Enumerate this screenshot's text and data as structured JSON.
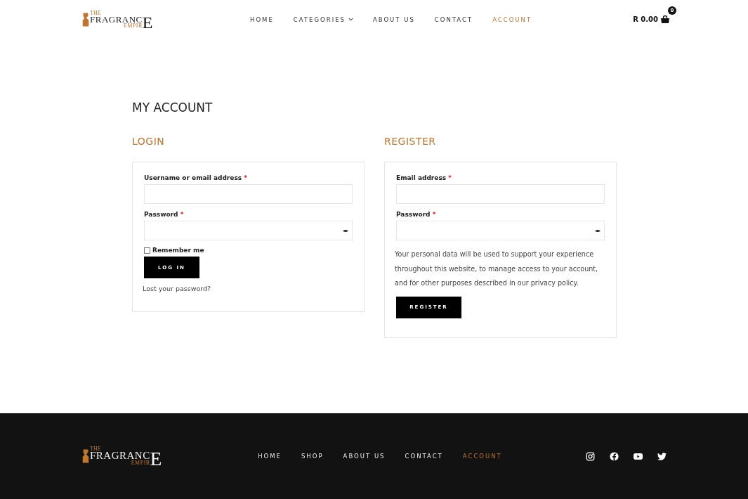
{
  "header": {
    "logo": {
      "top": "THE",
      "main": "FRAGRANC",
      "big": "E",
      "sub": "EMPIR"
    },
    "nav": [
      {
        "label": "HOME",
        "selected": false,
        "dropdown": false
      },
      {
        "label": "CATEGORIES",
        "selected": false,
        "dropdown": true
      },
      {
        "label": "ABOUT US",
        "selected": false,
        "dropdown": false
      },
      {
        "label": "CONTACT",
        "selected": false,
        "dropdown": false
      },
      {
        "label": "ACCOUNT",
        "selected": true,
        "dropdown": false
      }
    ],
    "cart": {
      "total": "R 0.00",
      "count": "0"
    }
  },
  "page_title": "MY ACCOUNT",
  "login": {
    "heading": "LOGIN",
    "fields": [
      {
        "label": "Username or email address",
        "required": "*",
        "kind": "text"
      },
      {
        "label": "Password",
        "required": "*",
        "kind": "password"
      }
    ],
    "remember": {
      "label": "Remember me",
      "checked": false
    },
    "button": "LOG IN",
    "lost_link": "Lost your password?"
  },
  "register": {
    "heading": "REGISTER",
    "fields": [
      {
        "label": "Email address",
        "required": "*",
        "kind": "text"
      },
      {
        "label": "Password",
        "required": "*",
        "kind": "password"
      }
    ],
    "privacy_text": "Your personal data will be used to support your experience throughout this website, to manage access to your account, and for other purposes described in our privacy policy.",
    "button": "REGISTER"
  },
  "footer": {
    "logo": {
      "top": "THE",
      "main": "FRAGRANC",
      "big": "E",
      "sub": "EMPIR"
    },
    "nav": [
      {
        "label": "HOME",
        "selected": false
      },
      {
        "label": "SHOP",
        "selected": false
      },
      {
        "label": "ABOUT US",
        "selected": false
      },
      {
        "label": "CONTACT",
        "selected": false
      },
      {
        "label": "ACCOUNT",
        "selected": true
      }
    ]
  }
}
